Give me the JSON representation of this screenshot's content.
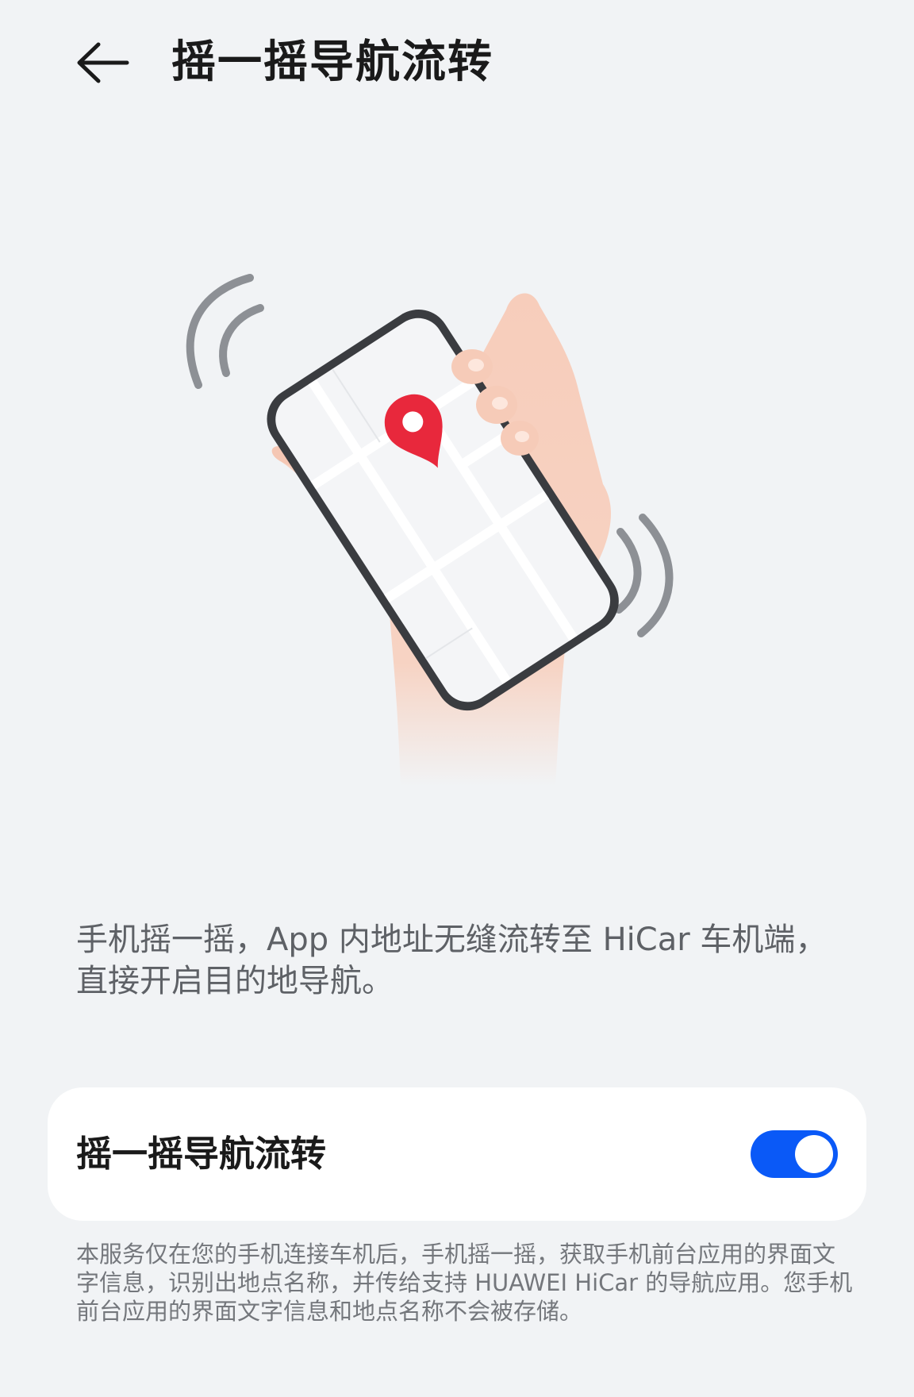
{
  "header": {
    "title": "摇一摇导航流转"
  },
  "description": "手机摇一摇，App 内地址无缝流转至 HiCar 车机端，直接开启目的地导航。",
  "setting": {
    "label": "摇一摇导航流转",
    "enabled": true
  },
  "footnote": "本服务仅在您的手机连接车机后，手机摇一摇，获取手机前台应用的界面文字信息，识别出地点名称，并传给支持 HUAWEI HiCar 的导航应用。您手机前台应用的界面文字信息和地点名称不会被存储。",
  "colors": {
    "accent": "#0a59f7",
    "background": "#f1f3f5",
    "pin": "#e8283c"
  },
  "icons": {
    "back": "arrow-left-icon",
    "pin": "map-pin-icon"
  }
}
